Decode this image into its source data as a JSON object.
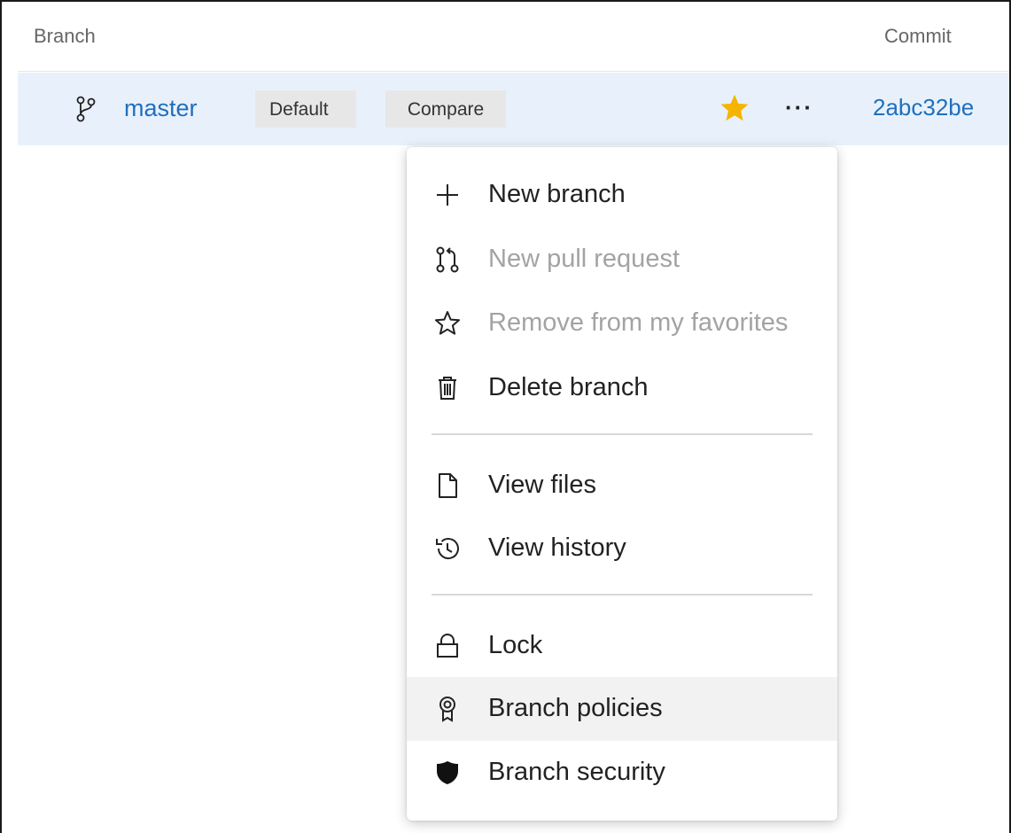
{
  "table": {
    "col_branch": "Branch",
    "col_commit": "Commit"
  },
  "row": {
    "branch_name": "master",
    "default_tag": "Default",
    "compare_label": "Compare",
    "more_label": "···",
    "commit_id": "2abc32be",
    "favorite": true
  },
  "menu": {
    "items": [
      {
        "label": "New branch",
        "icon": "plus-icon",
        "disabled": false
      },
      {
        "label": "New pull request",
        "icon": "pull-request-icon",
        "disabled": true
      },
      {
        "label": "Remove from my favorites",
        "icon": "star-outline-icon",
        "disabled": true
      },
      {
        "label": "Delete branch",
        "icon": "trash-icon",
        "disabled": false
      },
      {
        "label": "View files",
        "icon": "file-icon",
        "disabled": false
      },
      {
        "label": "View history",
        "icon": "history-icon",
        "disabled": false
      },
      {
        "label": "Lock",
        "icon": "lock-icon",
        "disabled": false
      },
      {
        "label": "Branch policies",
        "icon": "policy-badge-icon",
        "disabled": false,
        "hovered": true
      },
      {
        "label": "Branch security",
        "icon": "shield-icon",
        "disabled": false
      }
    ]
  },
  "colors": {
    "accent": "#1f6fbd",
    "row_highlight": "#e8f1fb",
    "star": "#f5b400",
    "disabled_text": "#a3a3a3"
  }
}
